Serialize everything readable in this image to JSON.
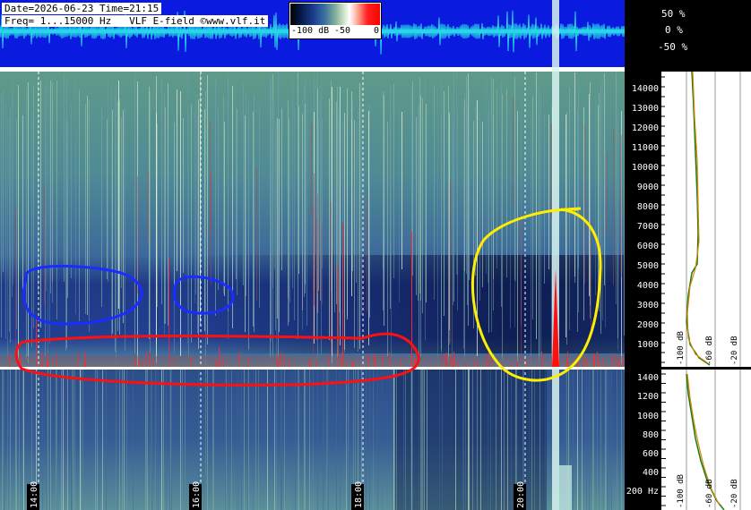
{
  "header": {
    "date_line": "Date=2026-06-23 Time=21:15",
    "freq_line": "Freq= 1...15000 Hz   VLF E-field ©www.vlf.it"
  },
  "colorbar": {
    "labels": [
      "-100 dB",
      "-50",
      "0"
    ]
  },
  "waveform_axis": {
    "labels": [
      "50 %",
      "0 %",
      "-50 %"
    ]
  },
  "upper_freq_axis": {
    "labels": [
      "14000",
      "13000",
      "12000",
      "11000",
      "10000",
      "9000",
      "8000",
      "7000",
      "6000",
      "5000",
      "4000",
      "3000",
      "2000",
      "1000"
    ]
  },
  "lower_freq_axis": {
    "labels": [
      "1400",
      "1200",
      "1000",
      "800",
      "600",
      "400",
      "200 Hz"
    ]
  },
  "spectrum_axis": {
    "upper_labels": [
      "-100 dB",
      "-60 dB",
      "-20 dB"
    ],
    "lower_labels": [
      "-100 dB",
      "-60 dB",
      "-20 dB"
    ]
  },
  "time_axis": {
    "labels": [
      "14:00",
      "16:00",
      "18:00",
      "20:00"
    ]
  },
  "colors": {
    "waveform_bg": "#0a1adf",
    "waveform_trace": "#27d6e6",
    "annotation_blue": "#1a2cff",
    "annotation_red": "#ff1010",
    "annotation_yellow": "#ffee00"
  }
}
